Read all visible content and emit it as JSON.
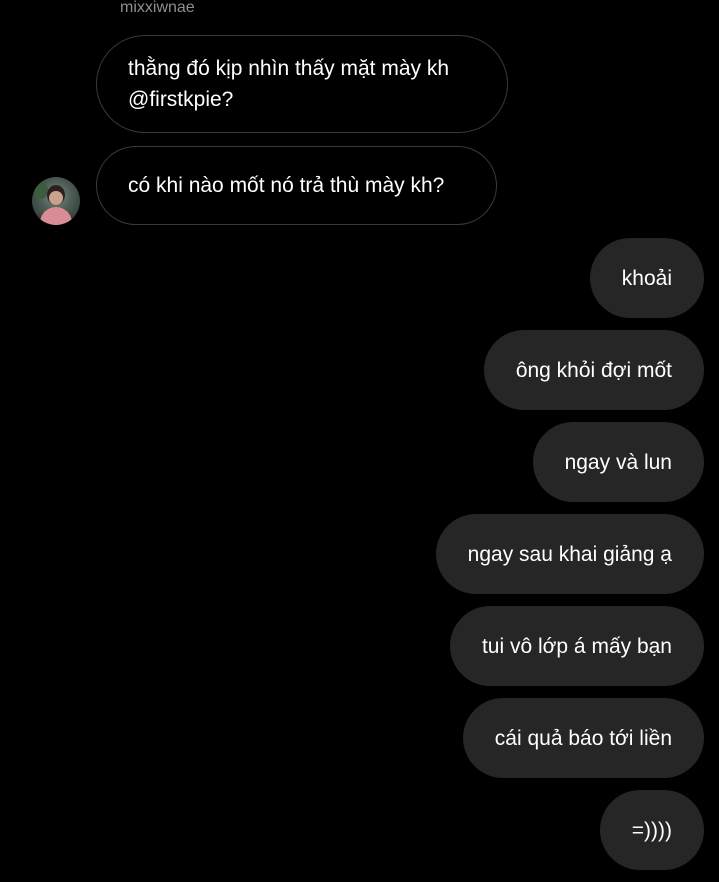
{
  "thread": {
    "sender_name": "mixxiwnae",
    "incoming": [
      {
        "line1": "thằng đó kịp nhìn thấy mặt mày kh",
        "line2": "@firstkpie?"
      },
      {
        "text": "có khi nào mốt nó trả thù mày kh?"
      }
    ],
    "outgoing": [
      "khoải",
      "ông khỏi đợi mốt",
      "ngay và lun",
      "ngay sau khai giảng ạ",
      "tui vô lớp á mấy bạn",
      "cái quả báo tới liền",
      "=))))"
    ]
  },
  "colors": {
    "background": "#000000",
    "outgoing_bubble": "#262626",
    "incoming_border": "#3a3a3a",
    "sender_name": "#8e8e8e",
    "text": "#ffffff"
  }
}
